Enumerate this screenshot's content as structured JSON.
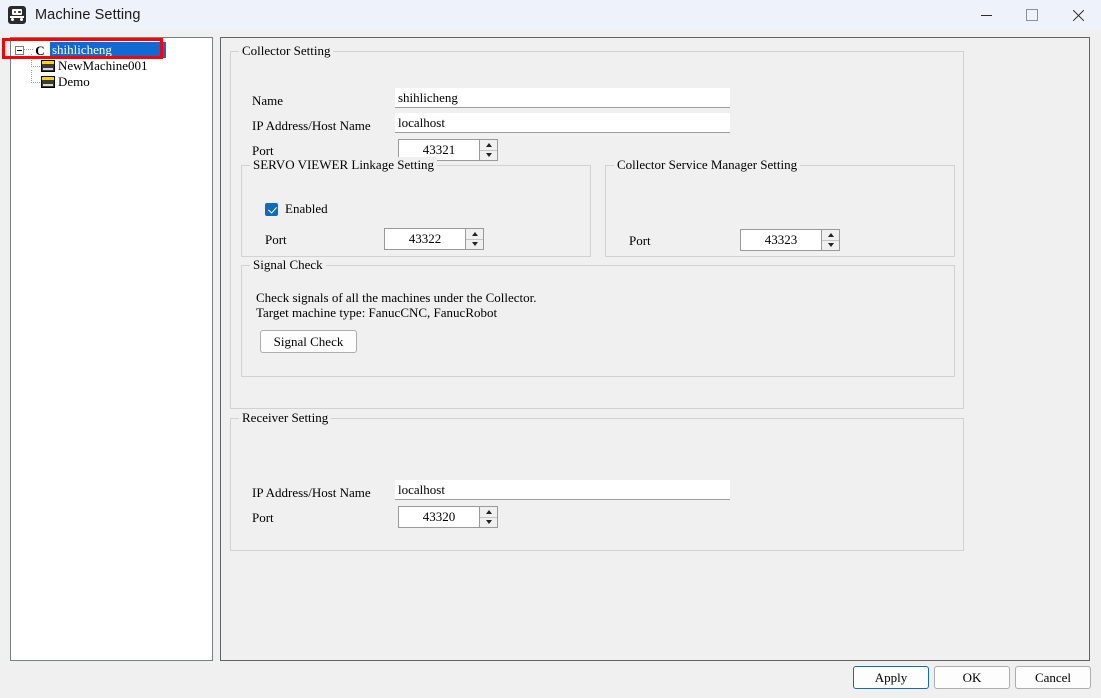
{
  "window": {
    "title": "Machine Setting",
    "icon": "machine-robot-icon",
    "minimize_label": "Minimize",
    "maximize_label": "Maximize",
    "close_label": "Close"
  },
  "tree": {
    "root": {
      "label": "shihlicheng",
      "icon": "collector-c-icon",
      "selected": true,
      "expanded": true
    },
    "children": [
      {
        "label": "NewMachine001",
        "icon": "machine-icon"
      },
      {
        "label": "Demo",
        "icon": "machine-icon"
      }
    ]
  },
  "annotation": {
    "color": "#ff0000",
    "target": "tree-root-row"
  },
  "collector_setting": {
    "title": "Collector Setting",
    "name_label": "Name",
    "name_value": "shihlicheng",
    "ip_label": "IP Address/Host Name",
    "ip_value": "localhost",
    "port_label": "Port",
    "port_value": "43321"
  },
  "servo_viewer": {
    "title": "SERVO VIEWER Linkage Setting",
    "enabled_label": "Enabled",
    "enabled_checked": true,
    "port_label": "Port",
    "port_value": "43322"
  },
  "collector_service_manager": {
    "title": "Collector Service Manager Setting",
    "port_label": "Port",
    "port_value": "43323"
  },
  "signal_check": {
    "title": "Signal Check",
    "description": "Check signals of all the machines under the Collector.\nTarget machine type: FanucCNC, FanucRobot",
    "button_label": "Signal Check"
  },
  "receiver_setting": {
    "title": "Receiver Setting",
    "ip_label": "IP Address/Host Name",
    "ip_value": "localhost",
    "port_label": "Port",
    "port_value": "43320"
  },
  "footer": {
    "apply_label": "Apply",
    "ok_label": "OK",
    "cancel_label": "Cancel",
    "focus_color": "#0f6cbd"
  }
}
